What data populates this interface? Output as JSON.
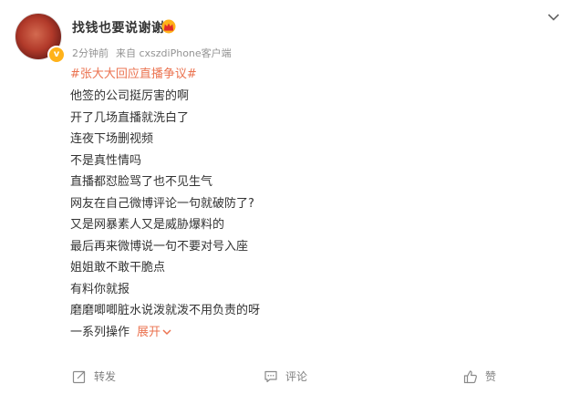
{
  "post": {
    "username": "找钱也要说谢谢",
    "time": "2分钟前",
    "source": "来自 cxszdiPhone客户端",
    "hashtag": "#张大大回应直播争议#",
    "lines": [
      "他签的公司挺厉害的啊",
      "开了几场直播就洗白了",
      "连夜下场删视频",
      "不是真性情吗",
      "直播都怼脸骂了也不见生气",
      "网友在自己微博评论一句就破防了?",
      "又是网暴素人又是威胁爆料的",
      "最后再来微博说一句不要对号入座",
      "姐姐敢不敢干脆点",
      "有料你就报",
      "磨磨唧唧脏水说泼就泼不用负责的呀"
    ],
    "last_line": "一系列操作",
    "expand_label": "展开"
  },
  "actions": {
    "repost": "转发",
    "comment": "评论",
    "like": "赞"
  },
  "icons": {
    "verified_badge": "verified-badge-icon",
    "vip_crown": "crown-icon",
    "more": "chevron-down-icon",
    "repost": "share-icon",
    "comment": "comment-icon",
    "like": "thumbs-up-icon"
  },
  "colors": {
    "accent": "#eb7350",
    "text": "#333333",
    "meta": "#939393",
    "badge": "#ffb21a"
  }
}
